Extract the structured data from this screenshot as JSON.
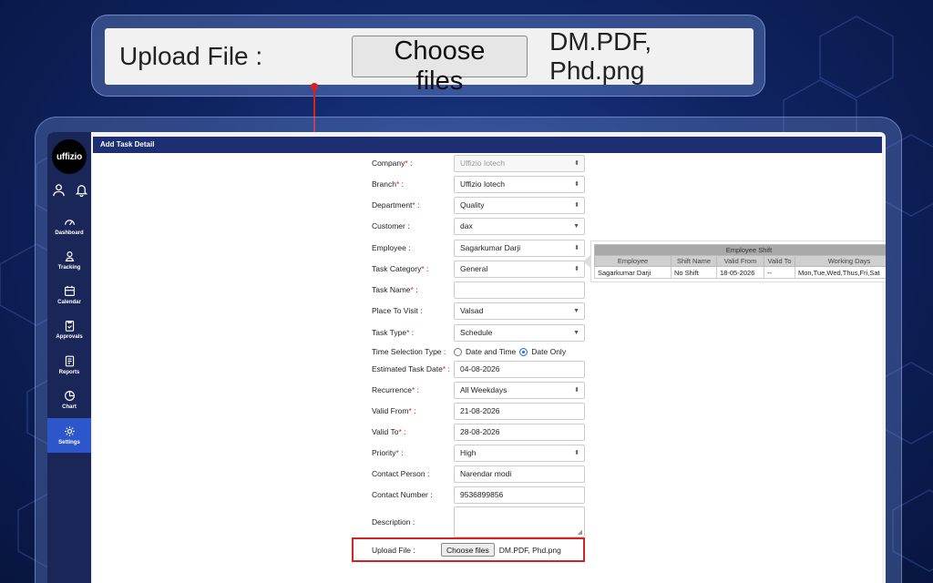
{
  "callout": {
    "label": "Upload File :",
    "button": "Choose files",
    "files": "DM.PDF, Phd.png"
  },
  "app": {
    "logo": "uffizio",
    "title": "Add Task Detail"
  },
  "sidebar": {
    "items": [
      {
        "label": "Dashboard",
        "icon": "gauge-icon"
      },
      {
        "label": "Tracking",
        "icon": "location-person-icon"
      },
      {
        "label": "Calendar",
        "icon": "calendar-icon"
      },
      {
        "label": "Approvals",
        "icon": "clipboard-icon"
      },
      {
        "label": "Reports",
        "icon": "report-icon"
      },
      {
        "label": "Chart",
        "icon": "pie-chart-icon"
      },
      {
        "label": "Settings",
        "icon": "gear-icon",
        "active": true
      }
    ]
  },
  "form": {
    "company": {
      "label": "Company",
      "value": "Uffizio Iotech"
    },
    "branch": {
      "label": "Branch",
      "value": "Uffizio Iotech"
    },
    "department": {
      "label": "Department",
      "value": "Quality"
    },
    "customer": {
      "label": "Customer :",
      "value": "dax"
    },
    "employee": {
      "label": "Employee :",
      "value": "Sagarkumar Darji"
    },
    "task_category": {
      "label": "Task Category",
      "value": "General"
    },
    "task_name": {
      "label": "Task Name",
      "value": ""
    },
    "place_to_visit": {
      "label": "Place To Visit :",
      "value": "Valsad"
    },
    "task_type": {
      "label": "Task Type",
      "value": "Schedule"
    },
    "time_selection": {
      "label": "Time Selection Type :",
      "option1": "Date and Time",
      "option2": "Date Only"
    },
    "estimated_date": {
      "label": "Estimated Task Date",
      "value": "04-08-2026"
    },
    "recurrence": {
      "label": "Recurrence",
      "value": "All Weekdays"
    },
    "valid_from": {
      "label": "Valid From",
      "value": "21-08-2026"
    },
    "valid_to": {
      "label": "Valid To",
      "value": "28-08-2026"
    },
    "priority": {
      "label": "Priority",
      "value": "High"
    },
    "contact_person": {
      "label": "Contact Person :",
      "value": "Narendar modi"
    },
    "contact_number": {
      "label": "Contact Number :",
      "value": "9536899856"
    },
    "description": {
      "label": "Description :",
      "value": ""
    },
    "upload": {
      "label": "Upload File :",
      "button": "Choose files",
      "files": "DM.PDF, Phd.png"
    }
  },
  "shift": {
    "caption": "Employee Shift",
    "headers": [
      "Employee",
      "Shift Name",
      "Valid From",
      "Valid To",
      "Working Days"
    ],
    "row": [
      "Sagarkumar Darji",
      "No Shift",
      "18-05-2026",
      "--",
      "Mon,Tue,Wed,Thus,Fri,Sat"
    ]
  },
  "colors": {
    "sidebar": "#1a2657",
    "active_nav": "#2c56c9",
    "titlebar": "#1d2f72",
    "highlight": "#d62222",
    "required": "#e02020"
  }
}
